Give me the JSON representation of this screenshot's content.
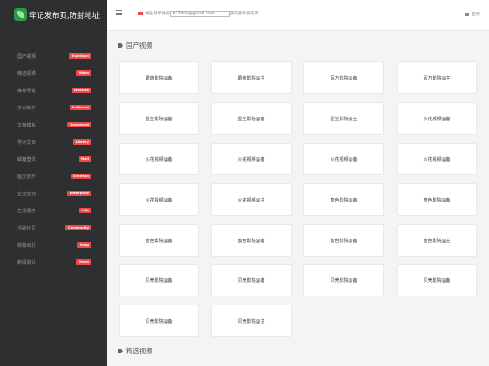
{
  "brand": {
    "title": "牢记发布页,防封地址"
  },
  "nav": [
    {
      "label": "国产视频",
      "badge": "BlueDaon"
    },
    {
      "label": "精选视频",
      "badge": "Video"
    },
    {
      "label": "推荐导航",
      "badge": "Website"
    },
    {
      "label": "办公软件",
      "badge": "Software"
    },
    {
      "label": "文档模板",
      "badge": "Document"
    },
    {
      "label": "学术文库",
      "badge": "Library"
    },
    {
      "label": "邮箱登录",
      "badge": "Mail"
    },
    {
      "label": "图文创作",
      "badge": "Creation"
    },
    {
      "label": "企业查询",
      "badge": "Enterprise"
    },
    {
      "label": "生活服务",
      "badge": "Life"
    },
    {
      "label": "活跃社区",
      "badge": "Community"
    },
    {
      "label": "购物出行",
      "badge": "Shop"
    },
    {
      "label": "新闻资讯",
      "badge": "News"
    }
  ],
  "topbar": {
    "mail_prefix": "发任意邮件到",
    "mail_value": "b320nn@gmail.com",
    "mail_suffix": "获取最新发布页",
    "home_label": "首页"
  },
  "sections": [
    {
      "title": "国产视频"
    },
    {
      "title": "精选视频"
    }
  ],
  "cards": [
    "蘑菇影院@备",
    "蘑菇影院@主",
    "百万影院@备",
    "百万影院@主",
    "星空影院@备",
    "星空影院@备",
    "星空影院@主",
    "火花视频@备",
    "火花视频@备",
    "火花视频@备",
    "火花视频@备",
    "火花视频@备",
    "火花视频@备",
    "火花视频@主",
    "蜜色影院@备",
    "蜜色影院@备",
    "蜜色影院@备",
    "蜜色影院@备",
    "蜜色影院@备",
    "蜜色影院@主",
    "贝壳影院@备",
    "贝壳影院@备",
    "贝壳影院@备",
    "贝壳影院@备",
    "贝壳影院@备",
    "贝壳影院@主"
  ]
}
